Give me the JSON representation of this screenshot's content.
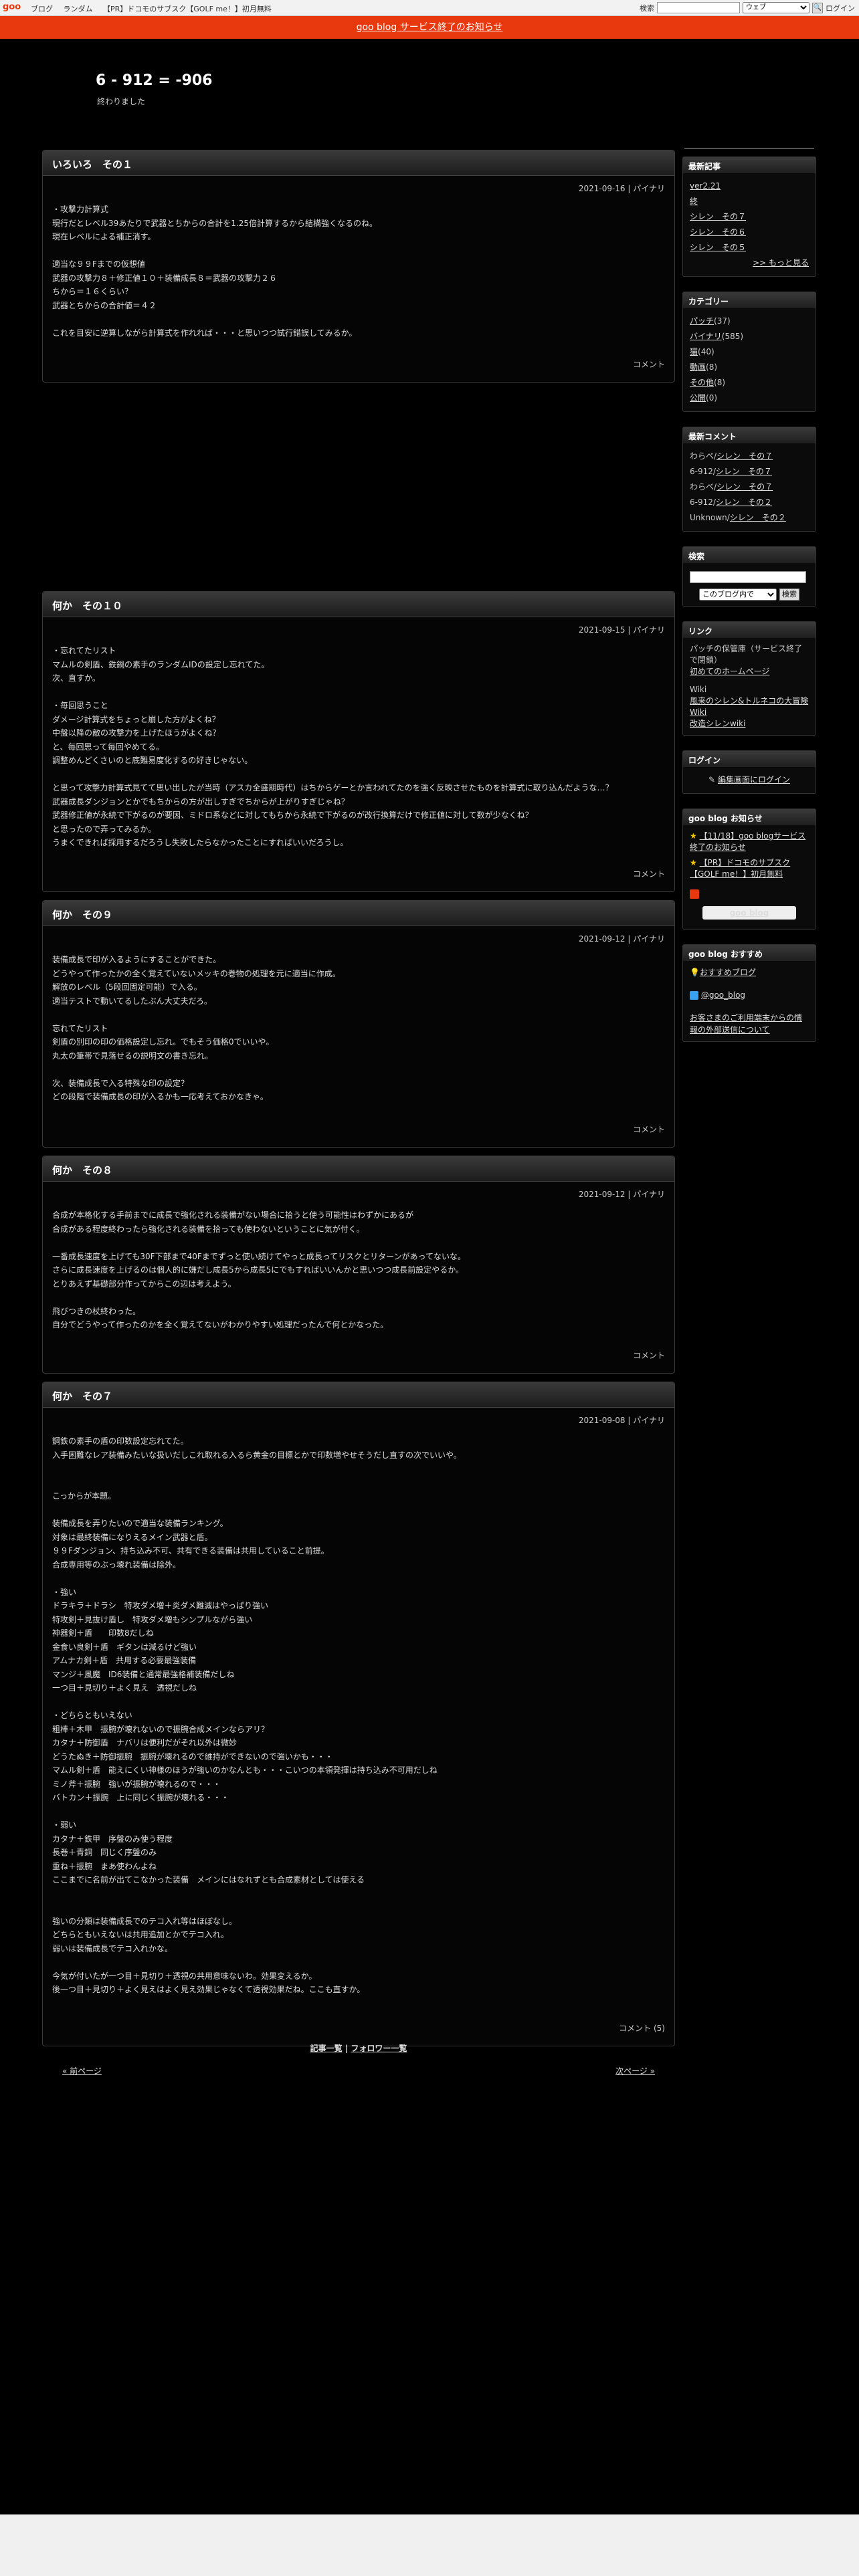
{
  "topbar": {
    "logo": "goo",
    "links": [
      "ブログ",
      "ランダム",
      "【PR】ドコモのサブスク【GOLF me！】初月無料"
    ],
    "search_label": "検索",
    "search_scope": "ウェブ",
    "login": "ログイン"
  },
  "notice": "goo blog サービス終了のお知らせ",
  "blog": {
    "title": "6 - 912 = -906",
    "description": "終わりました"
  },
  "entries": [
    {
      "title": "いろいろ　その１",
      "meta": "2021-09-16 | パイナリ",
      "body": "・攻撃力計算式\n現行だとレベル39あたりで武器とちからの合計を1.25倍計算するから結構強くなるのね。\n現在レベルによる補正消す。\n\n適当な９９Fまでの仮想値\n武器の攻撃力８＋修正値１０＋装備成長８＝武器の攻撃力２６\nちから＝１６くらい？\n武器とちからの合計値＝４２\n\nこれを目安に逆算しながら計算式を作れれば・・・と思いつつ試行錯誤してみるか。",
      "foot": "コメント"
    },
    {
      "title": "何か　その１０",
      "meta": "2021-09-15 | パイナリ",
      "body": "・忘れてたリスト\nマムルの剣盾、鉄鍋の素手のランダムIDの設定し忘れてた。\n次、直すか。\n\n・毎回思うこと\nダメージ計算式をちょっと崩した方がよくね？\n中盤以降の敵の攻撃力を上げたほうがよくね？\nと、毎回思って毎回やめてる。\n調整めんどくさいのと底難易度化するの好きじゃない。\n\nと思って攻撃力計算式見てて思い出したが当時（アスカ全盛期時代）はちからゲーとか言われてたのを強く反映させたものを計算式に取り込んだような…？\n武器成長ダンジョンとかでもちからの方が出しすぎでちからが上がりすぎじゃね？\n武器修正値が永続で下がるのが要因、ミドロ系などに対してもちから永続で下がるのが改行換算だけで修正値に対して数が少なくね？\nと思ったので弄ってみるか。\nうまくできれば採用するだろうし失敗したらなかったことにすればいいだろうし。",
      "foot": "コメント"
    },
    {
      "title": "何か　その９",
      "meta": "2021-09-12 | パイナリ",
      "body": "装備成長で印が入るようにすることができた。\nどうやって作ったかの全く覚えていないメッキの巻物の処理を元に適当に作成。\n解放のレベル（5段回固定可能）で入る。\n適当テストで動いてるしたぶん大丈夫だろ。\n\n忘れてたリスト\n剣盾の別印の印の価格設定し忘れ。でもそう価格0でいいや。\n丸太の筆帯で見落せるの説明文の書き忘れ。\n\n次、装備成長で入る特殊な印の設定？\nどの段階で装備成長の印が入るかも一応考えておかなきゃ。",
      "foot": "コメント"
    },
    {
      "title": "何か　その８",
      "meta": "2021-09-12 | パイナリ",
      "body": "合成が本格化する手前までに成長で強化される装備がない場合に拾うと使う可能性はわずかにあるが\n合成がある程度終わったら強化される装備を拾っても使わないということに気が付く。\n\n一番成長速度を上げても30F下部まで40Fまでずっと使い続けてやっと成長ってリスクとリターンがあってないな。\nさらに成長速度を上げるのは個人的に嫌だし成長5から成長5にでもすればいいんかと思いつつ成長前設定やるか。\nとりあえず基礎部分作ってからこの辺は考えよう。\n\n飛びつきの杖終わった。\n自分でどうやって作ったのかを全く覚えてないがわかりやすい処理だったんで何とかなった。",
      "foot": "コメント"
    },
    {
      "title": "何か　その７",
      "meta": "2021-09-08 | パイナリ",
      "body": "鋼鉄の素手の盾の印数設定忘れてた。\n入手困難なレア装備みたいな扱いだしこれ取れる入るら黄金の目標とかで印数増やせそうだし直すの次でいいや。\n\n\nこっからが本題。\n\n装備成長を弄りたいので適当な装備ランキング。\n対象は最終装備になりえるメイン武器と盾。\n９９Fダンジョン、持ち込み不可、共有できる装備は共用していること前提。\n合成専用等のぶっ壊れ装備は除外。\n\n・強い\nドラキラ＋ドラシ　特攻ダメ増＋炎ダメ難減はやっぱり強い\n特攻剣＋見抜け盾し　特攻ダメ増もシンプルながら強い\n神器剣＋盾　　印数8だしね\n金食い良剣＋盾　ギタンは減るけど強い\nアムナカ剣＋盾　共用する必要最強装備\nマンジ＋風魔　ID6装備と通常最強格補装備だしね\n一つ目＋見切り＋よく見え　透視だしね\n\n・どちらともいえない\n粗棒＋木甲　振腕が壊れないので振腕合成メインならアリ？\nカタナ＋防御盾　ナバリは便利だがそれ以外は微妙\nどうたぬき＋防御振腕　振腕が壊れるので維持ができないので強いかも・・・\nマムル剣＋盾　能えにくい神様のほうが強いのかなんとも・・・こいつの本領発揮は持ち込み不可用だしね\nミノ斧＋振腕　強いが振腕が壊れるので・・・\nバトカン＋振腕　上に同じく振腕が壊れる・・・\n\n・弱い\nカタナ＋鉄甲　序盤のみ使う程度\n長巻＋青銅　同じく序盤のみ\n重ね＋振腕　まあ使わんよね\nここまでに名前が出てこなかった装備　メインにはなれずとも合成素材としては使える\n\n\n強いの分類は装備成長でのテコ入れ等はほぼなし。\nどちらともいえないは共用追加とかでテコ入れ。\n弱いは装備成長でテコ入れかな。\n\n今気が付いたが一つ目＋見切り＋透視の共用意味ないわ。効果変えるか。\n後一つ目＋見切り＋よく見えはよく見え効果じゃなくて透視効果だね。ここも直すか。",
      "foot": "コメント (5)"
    }
  ],
  "bottom_links": {
    "articles": "記事一覧",
    "sep": "|",
    "followers": "フォロワー一覧"
  },
  "pager": {
    "prev": "« 前ページ",
    "next": "次ページ »"
  },
  "sidebar": {
    "recent": {
      "title": "最新記事",
      "items": [
        "ver2.21",
        "終",
        "シレン　その７",
        "シレン　その６",
        "シレン　その５"
      ],
      "more": ">> もっと見る"
    },
    "categories": {
      "title": "カテゴリー",
      "items": [
        {
          "name": "パッチ",
          "count": "(37)"
        },
        {
          "name": "バイナリ",
          "count": "(585)"
        },
        {
          "name": "猫",
          "count": "(40)"
        },
        {
          "name": "動画",
          "count": "(8)"
        },
        {
          "name": "その他",
          "count": "(8)"
        },
        {
          "name": "公開",
          "count": "(0)"
        }
      ]
    },
    "comments": {
      "title": "最新コメント",
      "items": [
        {
          "who": "わらべ",
          "post": "シレン　その７"
        },
        {
          "who": "6-912",
          "post": "シレン　その７"
        },
        {
          "who": "わらべ",
          "post": "シレン　その７"
        },
        {
          "who": "6-912",
          "post": "シレン　その２"
        },
        {
          "who": "Unknown",
          "post": "シレン　その２"
        }
      ]
    },
    "search": {
      "title": "検索",
      "scope": "このブログ内で",
      "button": "検索"
    },
    "links": {
      "title": "リンク",
      "patch_text": "パッチの保管庫（サービス終了で閉鎖）",
      "homepage": "初めてのホームページ",
      "wiki_label": "Wiki",
      "wiki1": "風来のシレン&トルネコの大冒険 Wiki",
      "wiki2": "改造シレンwiki"
    },
    "login": {
      "title": "ログイン",
      "button": "編集画面にログイン"
    },
    "goo_news": {
      "title": "goo blog お知らせ",
      "items": [
        "【11/18】goo blogサービス終了のお知らせ",
        "【PR】ドコモのサブスク【GOLF me！】初月無料"
      ]
    },
    "goo_blog_button": "goo blog",
    "recommend": {
      "title": "goo blog おすすめ",
      "item": "おすすめブログ"
    },
    "twitter": "@goo_blog",
    "external": "お客さまのご利用端末からの情報の外部送信について"
  },
  "colors": {
    "accent": "#e8380d",
    "background": "#000000"
  }
}
